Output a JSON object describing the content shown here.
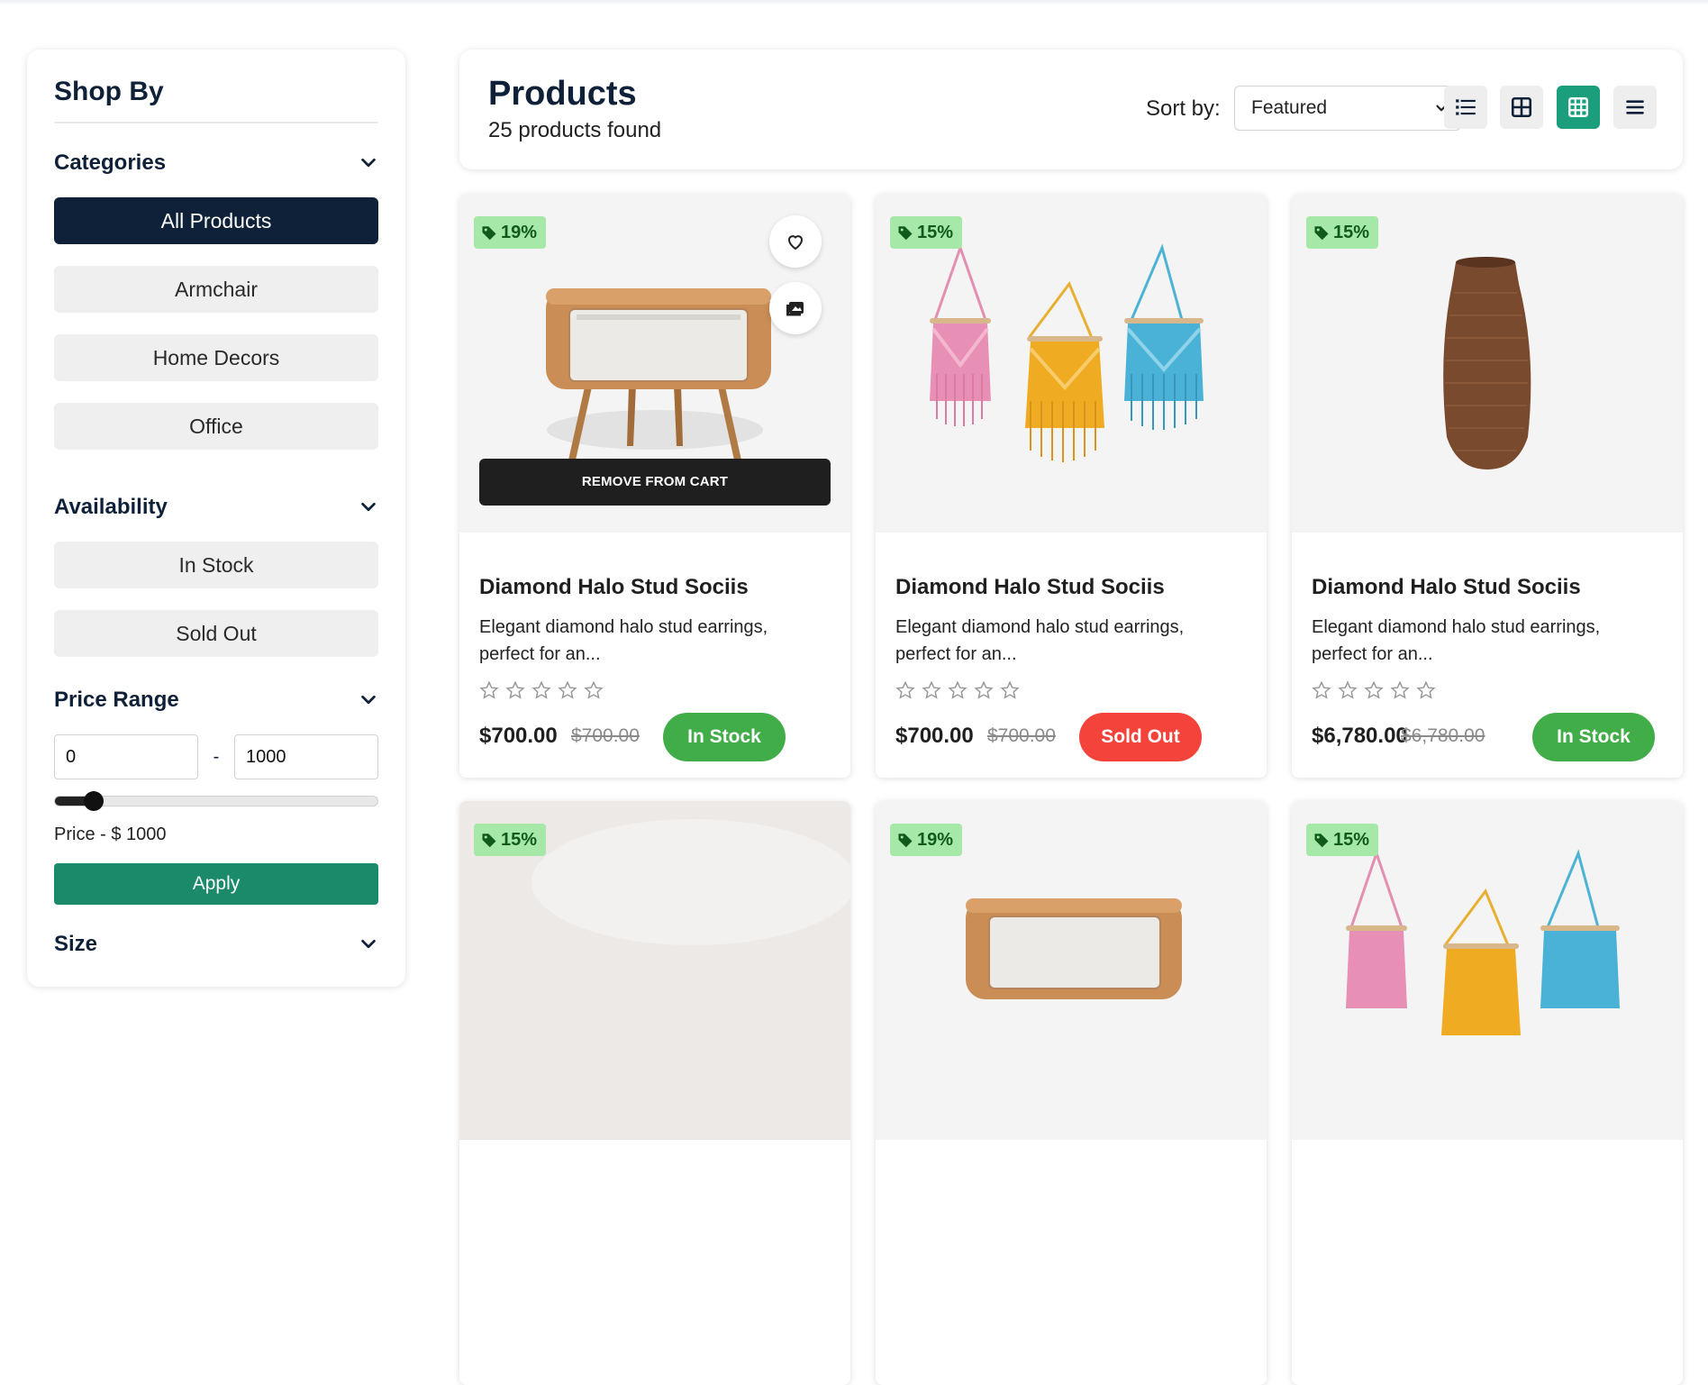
{
  "sidebar": {
    "title": "Shop By",
    "categories": {
      "title": "Categories",
      "items": [
        {
          "label": "All Products"
        },
        {
          "label": "Armchair"
        },
        {
          "label": "Home Decors"
        },
        {
          "label": "Office"
        }
      ]
    },
    "availability": {
      "title": "Availability",
      "items": [
        {
          "label": "In Stock"
        },
        {
          "label": "Sold Out"
        }
      ]
    },
    "price": {
      "title": "Price Range",
      "min_value": "0",
      "max_value": "1000",
      "separator": "-",
      "slider_level_fraction": 0.12,
      "label": "Price - $ 1000",
      "apply_label": "Apply"
    },
    "next_section_title": "Size"
  },
  "header": {
    "title": "Products",
    "count": "25 products found",
    "sort_label": "Sort by:",
    "sort_value": "Featured",
    "views": [
      "list-view-icon",
      "two-column-grid-icon",
      "three-column-grid-icon",
      "compact-list-icon"
    ],
    "active_view": "three-column-grid-icon"
  },
  "products": [
    {
      "discount": "19%",
      "image": "nightstand",
      "name": "Diamond Halo Stud Sociis",
      "desc": "Elegant diamond halo stud earrings, perfect for an...",
      "price": "$700.00",
      "old_price": "$700.00",
      "stock": "In Stock",
      "cart_label": "REMOVE FROM CART",
      "rating": 0
    },
    {
      "discount": "15%",
      "image": "macrame",
      "name": "Diamond Halo Stud Sociis",
      "desc": "Elegant diamond halo stud earrings, perfect for an...",
      "price": "$700.00",
      "old_price": "$700.00",
      "stock": "Sold Out",
      "rating": 0
    },
    {
      "discount": "15%",
      "image": "vase",
      "name": "Diamond Halo Stud Sociis",
      "desc": "Elegant diamond halo stud earrings, perfect for an...",
      "price": "$6,780.00",
      "old_price": "$6,780.00",
      "stock": "In Stock",
      "rating": 0
    },
    {
      "discount": "15%",
      "image": "blank"
    },
    {
      "discount": "19%",
      "image": "nightstand"
    },
    {
      "discount": "15%",
      "image": "macrame"
    }
  ],
  "colors": {
    "navy": "#0f2138",
    "green_apply": "#1b8a6b",
    "in_stock": "#41ad49",
    "sold_out": "#f4433a",
    "badge": "#a6e8a8",
    "active_view": "#1b9e7c"
  }
}
